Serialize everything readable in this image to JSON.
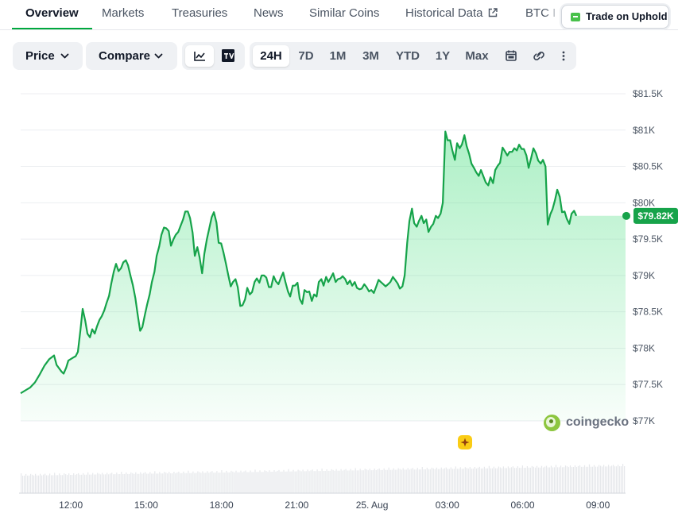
{
  "tabs": [
    {
      "label": "Overview",
      "active": true
    },
    {
      "label": "Markets"
    },
    {
      "label": "Treasuries"
    },
    {
      "label": "News"
    },
    {
      "label": "Similar Coins"
    },
    {
      "label": "Historical Data",
      "icon": "external-link-icon"
    },
    {
      "label": "BTC I"
    }
  ],
  "trade_button": {
    "label": "Trade on Uphold",
    "icon": "uphold-logo-icon"
  },
  "toolbar": {
    "price_dropdown": "Price",
    "compare_dropdown": "Compare",
    "chart_styles": [
      {
        "name": "line-chart-icon",
        "active": true
      },
      {
        "name": "tradingview-icon",
        "active": false
      }
    ],
    "ranges": [
      "24H",
      "7D",
      "1M",
      "3M",
      "YTD",
      "1Y",
      "Max"
    ],
    "active_range": "24H",
    "icons": [
      "calendar-icon",
      "link-icon",
      "more-vertical-icon"
    ]
  },
  "watermark": {
    "brand": "coingecko"
  },
  "colors": {
    "accent": "#00a83e",
    "line": "#16a34a",
    "fill": "#4ade80",
    "badge": "#16a34a",
    "marker": "#facc15"
  },
  "chart_data": {
    "type": "area",
    "title": "",
    "xlabel": "",
    "ylabel": "",
    "x_ticks": [
      "12:00",
      "15:00",
      "18:00",
      "21:00",
      "25. Aug",
      "03:00",
      "06:00",
      "09:00"
    ],
    "y_ticks": [
      "$77K",
      "$77.5K",
      "$78K",
      "$78.5K",
      "$79K",
      "$79.5K",
      "$80K",
      "$80.5K",
      "$81K",
      "$81.5K"
    ],
    "ylim": [
      77000,
      81500
    ],
    "x_unit": "hours since 10:00",
    "xlim": [
      0,
      24.1
    ],
    "current_price_label": "$79.82K",
    "current_price": 79820,
    "grid": true,
    "volume_bars": true,
    "event_marker": {
      "x": 17.85
    },
    "series": [
      {
        "points": [
          [
            0.0,
            77380
          ],
          [
            0.19,
            77420
          ],
          [
            0.38,
            77460
          ],
          [
            0.57,
            77530
          ],
          [
            0.76,
            77640
          ],
          [
            0.95,
            77760
          ],
          [
            1.14,
            77850
          ],
          [
            1.33,
            77900
          ],
          [
            1.43,
            77770
          ],
          [
            1.62,
            77680
          ],
          [
            1.71,
            77650
          ],
          [
            1.81,
            77730
          ],
          [
            1.9,
            77830
          ],
          [
            2.09,
            77870
          ],
          [
            2.19,
            77890
          ],
          [
            2.28,
            77950
          ],
          [
            2.38,
            78250
          ],
          [
            2.47,
            78540
          ],
          [
            2.57,
            78380
          ],
          [
            2.66,
            78200
          ],
          [
            2.76,
            78150
          ],
          [
            2.85,
            78260
          ],
          [
            2.95,
            78200
          ],
          [
            3.04,
            78300
          ],
          [
            3.14,
            78390
          ],
          [
            3.23,
            78440
          ],
          [
            3.33,
            78520
          ],
          [
            3.42,
            78620
          ],
          [
            3.52,
            78720
          ],
          [
            3.61,
            78890
          ],
          [
            3.71,
            79050
          ],
          [
            3.8,
            79160
          ],
          [
            3.9,
            79060
          ],
          [
            4.0,
            79100
          ],
          [
            4.09,
            79180
          ],
          [
            4.19,
            79210
          ],
          [
            4.28,
            79140
          ],
          [
            4.38,
            78990
          ],
          [
            4.47,
            78870
          ],
          [
            4.57,
            78690
          ],
          [
            4.66,
            78470
          ],
          [
            4.76,
            78240
          ],
          [
            4.85,
            78290
          ],
          [
            4.95,
            78460
          ],
          [
            5.04,
            78600
          ],
          [
            5.14,
            78740
          ],
          [
            5.23,
            78910
          ],
          [
            5.33,
            79050
          ],
          [
            5.42,
            79270
          ],
          [
            5.52,
            79400
          ],
          [
            5.61,
            79560
          ],
          [
            5.71,
            79660
          ],
          [
            5.8,
            79650
          ],
          [
            5.9,
            79610
          ],
          [
            5.99,
            79410
          ],
          [
            6.09,
            79500
          ],
          [
            6.18,
            79560
          ],
          [
            6.28,
            79600
          ],
          [
            6.37,
            79680
          ],
          [
            6.47,
            79770
          ],
          [
            6.56,
            79880
          ],
          [
            6.66,
            79880
          ],
          [
            6.75,
            79790
          ],
          [
            6.85,
            79590
          ],
          [
            6.94,
            79270
          ],
          [
            7.04,
            79390
          ],
          [
            7.13,
            79250
          ],
          [
            7.23,
            79030
          ],
          [
            7.32,
            79300
          ],
          [
            7.42,
            79500
          ],
          [
            7.51,
            79640
          ],
          [
            7.61,
            79800
          ],
          [
            7.7,
            79870
          ],
          [
            7.8,
            79730
          ],
          [
            7.89,
            79450
          ],
          [
            7.99,
            79440
          ],
          [
            8.08,
            79320
          ],
          [
            8.18,
            79160
          ],
          [
            8.27,
            79010
          ],
          [
            8.37,
            78850
          ],
          [
            8.46,
            78910
          ],
          [
            8.56,
            78950
          ],
          [
            8.65,
            78840
          ],
          [
            8.75,
            78580
          ],
          [
            8.84,
            78590
          ],
          [
            8.94,
            78670
          ],
          [
            9.03,
            78830
          ],
          [
            9.13,
            78740
          ],
          [
            9.22,
            78770
          ],
          [
            9.32,
            78910
          ],
          [
            9.41,
            78960
          ],
          [
            9.51,
            78900
          ],
          [
            9.6,
            79000
          ],
          [
            9.7,
            79000
          ],
          [
            9.79,
            78970
          ],
          [
            9.89,
            78840
          ],
          [
            9.98,
            78840
          ],
          [
            10.08,
            78990
          ],
          [
            10.17,
            78920
          ],
          [
            10.27,
            78880
          ],
          [
            10.36,
            78960
          ],
          [
            10.46,
            79040
          ],
          [
            10.55,
            78910
          ],
          [
            10.65,
            78780
          ],
          [
            10.74,
            78710
          ],
          [
            10.84,
            78860
          ],
          [
            10.93,
            78860
          ],
          [
            11.03,
            78900
          ],
          [
            11.12,
            78680
          ],
          [
            11.22,
            78610
          ],
          [
            11.31,
            78800
          ],
          [
            11.41,
            78770
          ],
          [
            11.5,
            78780
          ],
          [
            11.6,
            78650
          ],
          [
            11.69,
            78740
          ],
          [
            11.79,
            78710
          ],
          [
            11.88,
            78910
          ],
          [
            11.98,
            78950
          ],
          [
            12.07,
            78860
          ],
          [
            12.17,
            78980
          ],
          [
            12.26,
            78910
          ],
          [
            12.36,
            78970
          ],
          [
            12.45,
            79030
          ],
          [
            12.55,
            78910
          ],
          [
            12.64,
            78950
          ],
          [
            12.74,
            78960
          ],
          [
            12.83,
            78990
          ],
          [
            12.93,
            78950
          ],
          [
            13.02,
            78880
          ],
          [
            13.12,
            78930
          ],
          [
            13.21,
            78860
          ],
          [
            13.31,
            78910
          ],
          [
            13.4,
            78830
          ],
          [
            13.5,
            78810
          ],
          [
            13.59,
            78820
          ],
          [
            13.69,
            78880
          ],
          [
            13.78,
            78840
          ],
          [
            13.88,
            78780
          ],
          [
            13.97,
            78800
          ],
          [
            14.07,
            78760
          ],
          [
            14.16,
            78840
          ],
          [
            14.26,
            78940
          ],
          [
            14.35,
            78910
          ],
          [
            14.45,
            78880
          ],
          [
            14.54,
            78850
          ],
          [
            14.64,
            78880
          ],
          [
            14.73,
            78910
          ],
          [
            14.83,
            78980
          ],
          [
            14.92,
            78940
          ],
          [
            15.02,
            78890
          ],
          [
            15.11,
            78820
          ],
          [
            15.21,
            78850
          ],
          [
            15.3,
            79000
          ],
          [
            15.4,
            79450
          ],
          [
            15.49,
            79750
          ],
          [
            15.59,
            79920
          ],
          [
            15.68,
            79720
          ],
          [
            15.78,
            79670
          ],
          [
            15.87,
            79750
          ],
          [
            15.97,
            79820
          ],
          [
            16.06,
            79720
          ],
          [
            16.16,
            79770
          ],
          [
            16.25,
            79600
          ],
          [
            16.35,
            79670
          ],
          [
            16.44,
            79710
          ],
          [
            16.54,
            79820
          ],
          [
            16.63,
            79790
          ],
          [
            16.73,
            79850
          ],
          [
            16.82,
            80000
          ],
          [
            16.92,
            80980
          ],
          [
            17.01,
            80860
          ],
          [
            17.11,
            80860
          ],
          [
            17.2,
            80720
          ],
          [
            17.3,
            80590
          ],
          [
            17.39,
            80820
          ],
          [
            17.49,
            80750
          ],
          [
            17.58,
            80800
          ],
          [
            17.68,
            80930
          ],
          [
            17.77,
            80780
          ],
          [
            17.87,
            80670
          ],
          [
            17.96,
            80540
          ],
          [
            18.06,
            80480
          ],
          [
            18.15,
            80420
          ],
          [
            18.25,
            80370
          ],
          [
            18.34,
            80450
          ],
          [
            18.44,
            80360
          ],
          [
            18.53,
            80280
          ],
          [
            18.63,
            80240
          ],
          [
            18.72,
            80350
          ],
          [
            18.82,
            80270
          ],
          [
            18.91,
            80450
          ],
          [
            19.01,
            80510
          ],
          [
            19.1,
            80550
          ],
          [
            19.2,
            80760
          ],
          [
            19.29,
            80710
          ],
          [
            19.39,
            80650
          ],
          [
            19.48,
            80700
          ],
          [
            19.58,
            80700
          ],
          [
            19.67,
            80750
          ],
          [
            19.77,
            80720
          ],
          [
            19.86,
            80800
          ],
          [
            19.96,
            80740
          ],
          [
            20.05,
            80740
          ],
          [
            20.15,
            80650
          ],
          [
            20.24,
            80480
          ],
          [
            20.34,
            80620
          ],
          [
            20.43,
            80750
          ],
          [
            20.53,
            80680
          ],
          [
            20.62,
            80580
          ],
          [
            20.72,
            80540
          ],
          [
            20.81,
            80590
          ],
          [
            20.91,
            80500
          ],
          [
            21.0,
            79700
          ],
          [
            21.1,
            79840
          ],
          [
            21.19,
            79910
          ],
          [
            21.29,
            80040
          ],
          [
            21.38,
            80180
          ],
          [
            21.48,
            80080
          ],
          [
            21.57,
            79870
          ],
          [
            21.67,
            79880
          ],
          [
            21.76,
            79780
          ],
          [
            21.86,
            79710
          ],
          [
            21.95,
            79850
          ],
          [
            22.05,
            79890
          ],
          [
            22.14,
            79820
          ]
        ]
      }
    ]
  }
}
